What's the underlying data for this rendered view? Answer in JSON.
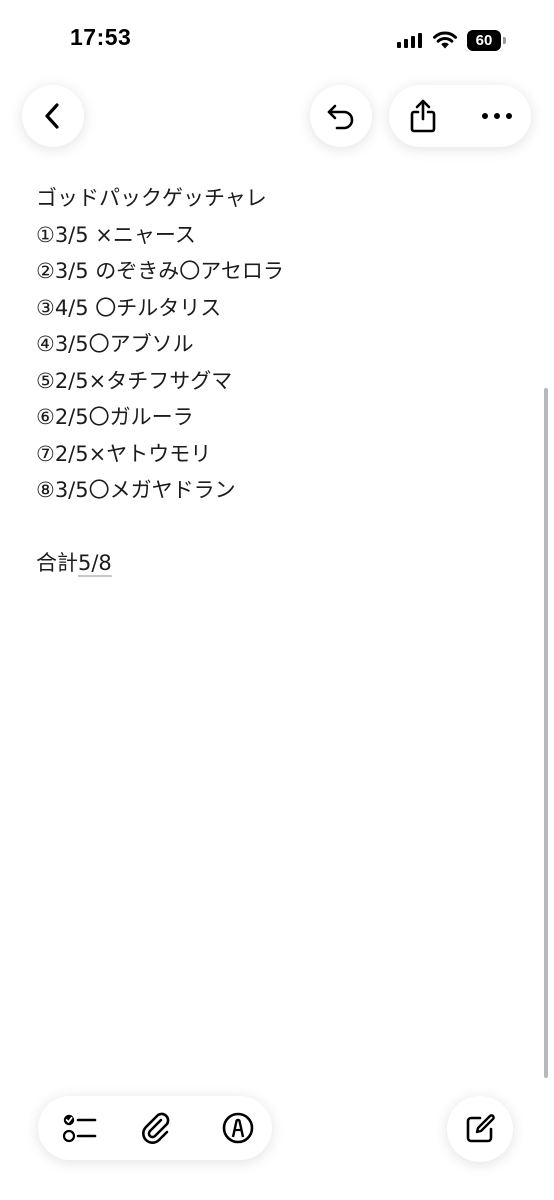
{
  "status_bar": {
    "time": "17:53",
    "battery_level": "60",
    "signal_icon": "cellular-signal-icon",
    "wifi_icon": "wifi-icon"
  },
  "toolbar": {
    "back_icon": "chevron-left-icon",
    "undo_icon": "undo-icon",
    "share_icon": "share-icon",
    "more_icon": "ellipsis-icon"
  },
  "note": {
    "title": "ゴッドパックゲッチャレ",
    "lines": [
      "①3/5 ×ニャース",
      "②3/5 のぞきみ〇アセロラ",
      "③4/5 〇チルタリス",
      "④3/5〇アブソル",
      "⑤2/5×タチフサグマ",
      "⑥2/5〇ガルーラ",
      "⑦2/5×ヤトウモリ",
      "⑧3/5〇メガヤドラン"
    ],
    "total_label": "合計",
    "total_value": "5/8"
  },
  "bottom_toolbar": {
    "checklist_icon": "checklist-icon",
    "attachment_icon": "paperclip-icon",
    "markup_icon": "markup-pen-icon",
    "compose_icon": "compose-icon"
  }
}
